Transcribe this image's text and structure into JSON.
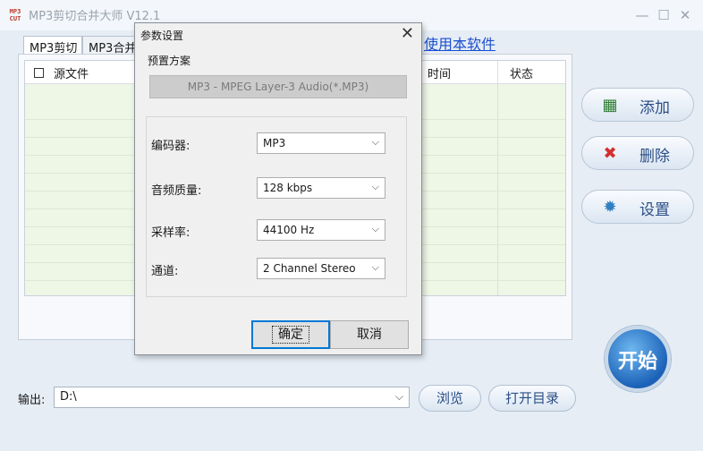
{
  "window": {
    "app_icon_text": "MP3 CUT",
    "title": "MP3剪切合并大师 V12.1",
    "minimize": "—",
    "maximize": "☐",
    "close": "✕"
  },
  "tabs": [
    {
      "label": "MP3剪切"
    },
    {
      "label": "MP3合并"
    }
  ],
  "help_link": "使用本软件",
  "grid": {
    "columns": [
      "源文件",
      "时间",
      "状态"
    ]
  },
  "side_buttons": [
    {
      "label": "添加",
      "icon": "film-add-icon",
      "glyph": "▦",
      "color": "#2e7d32"
    },
    {
      "label": "删除",
      "icon": "delete-x-icon",
      "glyph": "✖",
      "color": "#d32f2f"
    },
    {
      "label": "设置",
      "icon": "settings-gear-icon",
      "glyph": "✹",
      "color": "#2f7fc1"
    }
  ],
  "start_button": "开始",
  "output": {
    "label": "输出:",
    "value": "D:\\"
  },
  "browse_button": "浏览",
  "open_dir_button": "打开目录",
  "dialog": {
    "title": "参数设置",
    "close": "✕",
    "preset_label": "预置方案",
    "preset_value": "MP3 - MPEG Layer-3 Audio(*.MP3)",
    "fields": [
      {
        "label": "编码器:",
        "value": "MP3"
      },
      {
        "label": "音频质量:",
        "value": "128 kbps"
      },
      {
        "label": "采样率:",
        "value": "44100 Hz"
      },
      {
        "label": "通道:",
        "value": "2 Channel Stereo"
      }
    ],
    "ok_button": "确定",
    "cancel_button": "取消"
  }
}
